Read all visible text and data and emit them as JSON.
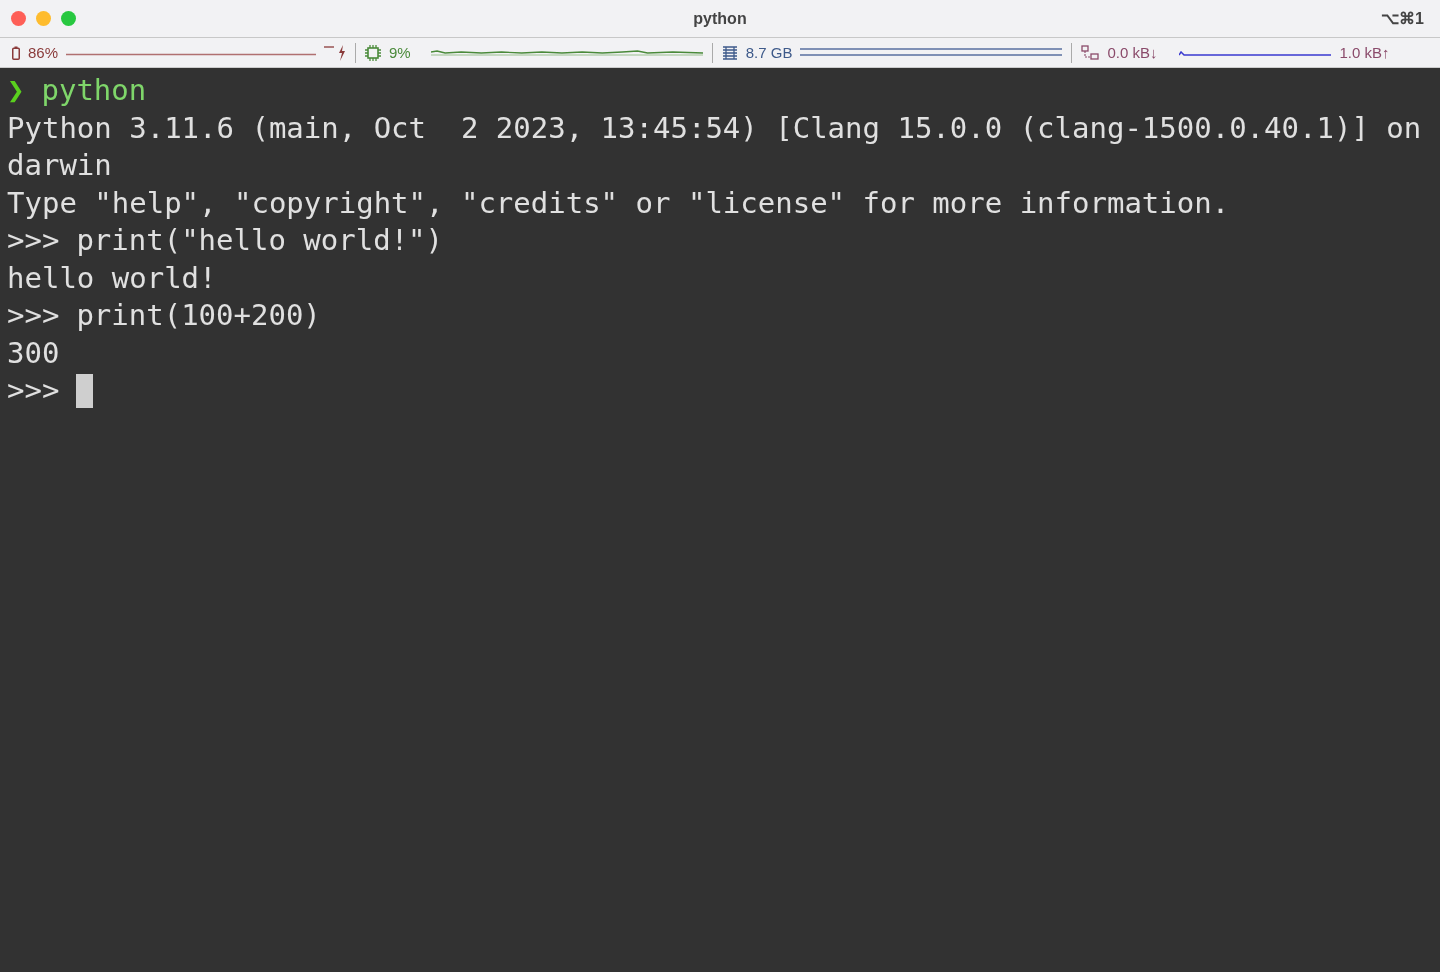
{
  "window": {
    "title": "python",
    "shortcut": "⌥⌘1"
  },
  "status_bar": [
    {
      "kind": "battery",
      "reading": "86%"
    },
    {
      "kind": "cpu",
      "reading": "9%"
    },
    {
      "kind": "memory",
      "reading": "8.7 GB"
    },
    {
      "kind": "network",
      "reading": "0.0 kB↓",
      "reading_2": "1.0 kB↑"
    }
  ],
  "terminal": {
    "lines": [
      {
        "kind": "shell",
        "prompt": "❯",
        "text": "python"
      },
      {
        "kind": "output",
        "text": "Python 3.11.6 (main, Oct  2 2023, 13:45:54) [Clang 15.0.0 (clang-1500.0.40.1)] on"
      },
      {
        "kind": "output",
        "text": "darwin"
      },
      {
        "kind": "output",
        "text": "Type \"help\", \"copyright\", \"credits\" or \"license\" for more information."
      },
      {
        "kind": "repl",
        "prompt": ">>>",
        "text": "print(\"hello world!\")"
      },
      {
        "kind": "output",
        "text": "hello world!"
      },
      {
        "kind": "repl",
        "prompt": ">>>",
        "text": "print(100+200)"
      },
      {
        "kind": "output",
        "text": "300"
      },
      {
        "kind": "cursor",
        "prompt": ">>>"
      }
    ]
  }
}
